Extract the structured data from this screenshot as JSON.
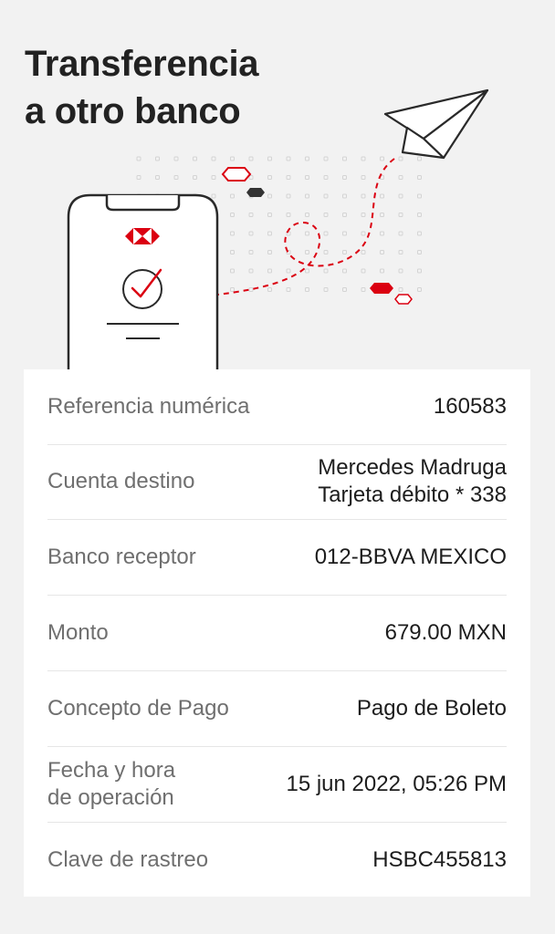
{
  "header": {
    "title_line1": "Transferencia",
    "title_line2": "a otro banco"
  },
  "illustration": {
    "brand_color": "#db0011",
    "icons": [
      "phone-icon",
      "hsbc-logo-icon",
      "check-circle-icon",
      "paper-plane-icon"
    ]
  },
  "details": {
    "rows": [
      {
        "label": "Referencia numérica",
        "value": "160583"
      },
      {
        "label": "Cuenta destino",
        "value_line1": "Mercedes Madruga",
        "value_line2": "Tarjeta débito * 338"
      },
      {
        "label": "Banco receptor",
        "value": "012-BBVA MEXICO"
      },
      {
        "label": "Monto",
        "value": "679.00 MXN"
      },
      {
        "label": "Concepto de Pago",
        "value": "Pago de Boleto"
      },
      {
        "label_line1": "Fecha y hora",
        "label_line2": "de operación",
        "value": "15 jun 2022, 05:26 PM"
      },
      {
        "label": "Clave de rastreo",
        "value": "HSBC455813"
      }
    ]
  }
}
